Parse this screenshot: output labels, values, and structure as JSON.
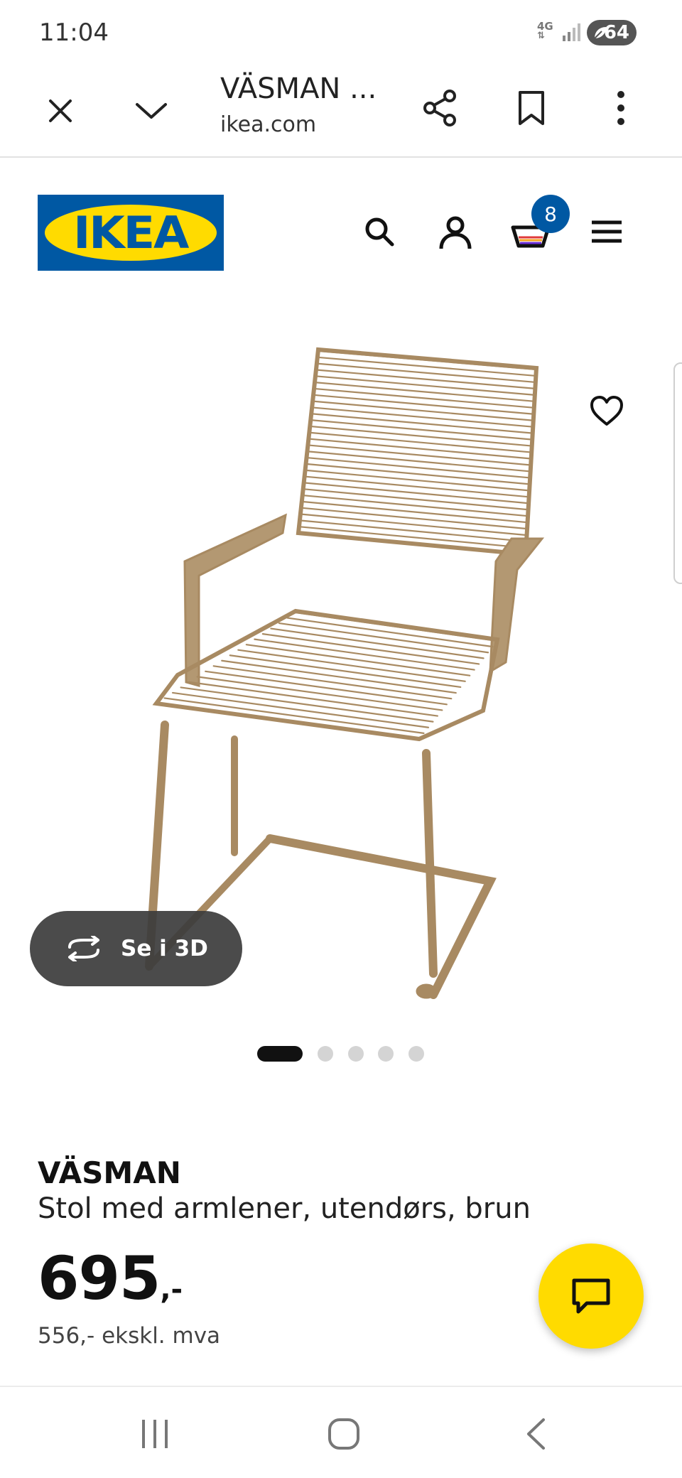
{
  "status_bar": {
    "time": "11:04",
    "network": "4G",
    "battery": "64"
  },
  "browser": {
    "tab_title": "VÄSMAN ...",
    "url": "ikea.com",
    "icons": [
      "close-icon",
      "chevron-down-icon",
      "share-icon",
      "bookmark-icon",
      "more-vert-icon"
    ]
  },
  "site_header": {
    "logo_text": "IKEA",
    "cart_count": "8",
    "icons": [
      "search-icon",
      "account-icon",
      "cart-icon",
      "menu-icon"
    ]
  },
  "gallery": {
    "button_3d_label": "Se i 3D",
    "image_count": 5,
    "active_index": 0
  },
  "product": {
    "name": "VÄSMAN",
    "description": "Stol med armlener, utendørs, brun",
    "price_integer": "695",
    "price_suffix": ",-",
    "price_ex_vat": "556,- ekskl. mva"
  },
  "colors": {
    "ikea_blue": "#0058a3",
    "ikea_yellow": "#ffdb00",
    "chair_brown": "#a88a62"
  }
}
